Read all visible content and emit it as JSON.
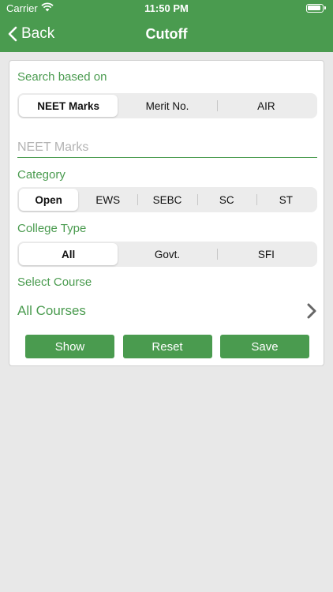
{
  "status_bar": {
    "carrier": "Carrier",
    "time": "11:50 PM"
  },
  "nav": {
    "back_label": "Back",
    "title": "Cutoff"
  },
  "search": {
    "label": "Search based on",
    "options": [
      "NEET Marks",
      "Merit No.",
      "AIR"
    ],
    "selected": "NEET Marks"
  },
  "marks_input": {
    "placeholder": "NEET Marks",
    "value": ""
  },
  "category": {
    "label": "Category",
    "options": [
      "Open",
      "EWS",
      "SEBC",
      "SC",
      "ST"
    ],
    "selected": "Open"
  },
  "college_type": {
    "label": "College Type",
    "options": [
      "All",
      "Govt.",
      "SFI"
    ],
    "selected": "All"
  },
  "course": {
    "label": "Select Course",
    "value": "All Courses"
  },
  "actions": {
    "show": "Show",
    "reset": "Reset",
    "save": "Save"
  },
  "colors": {
    "accent": "#4a9b4f",
    "background": "#e8e8e8"
  }
}
